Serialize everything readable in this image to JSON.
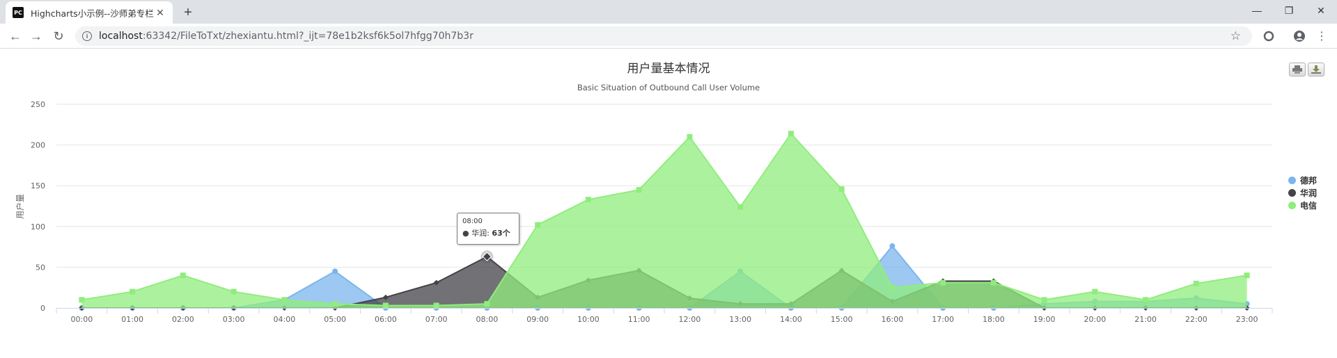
{
  "browser": {
    "tab_title": "Highcharts小示例--沙师弟专栏",
    "favicon_text": "PC",
    "url_host": "localhost",
    "url_rest": ":63342/FileToTxt/zhexiantu.html?_ijt=78e1b2ksf6k5ol7hfgg70h7b3r"
  },
  "colors": {
    "debang": "#7cb5ec",
    "huarun": "#434348",
    "dianxin": "#90ed7d"
  },
  "icons": [
    "back-icon",
    "forward-icon",
    "reload-icon",
    "info-icon",
    "star-icon",
    "extension-icon",
    "profile-icon",
    "menu-icon",
    "print-icon",
    "download-icon"
  ],
  "chart_data": {
    "type": "area",
    "title": "用户量基本情况",
    "subtitle": "Basic Situation of Outbound Call User Volume",
    "ylabel": "用户量",
    "xlabel": "",
    "ylim": [
      0,
      250
    ],
    "yticks": [
      0,
      50,
      100,
      150,
      200,
      250
    ],
    "grid": true,
    "legend_position": "right",
    "categories": [
      "00:00",
      "01:00",
      "02:00",
      "03:00",
      "04:00",
      "05:00",
      "06:00",
      "07:00",
      "08:00",
      "09:00",
      "10:00",
      "11:00",
      "12:00",
      "13:00",
      "14:00",
      "15:00",
      "16:00",
      "17:00",
      "18:00",
      "19:00",
      "20:00",
      "21:00",
      "22:00",
      "23:00"
    ],
    "series": [
      {
        "name": "德邦",
        "color": "#7cb5ec",
        "marker": "circle",
        "values": [
          0,
          0,
          0,
          0,
          10,
          45,
          0,
          0,
          0,
          0,
          0,
          0,
          0,
          45,
          0,
          0,
          76,
          0,
          0,
          5,
          8,
          8,
          12,
          5
        ]
      },
      {
        "name": "华润",
        "color": "#434348",
        "marker": "diamond",
        "values": [
          0,
          0,
          0,
          0,
          0,
          0,
          13,
          31,
          63,
          13,
          34,
          46,
          12,
          5,
          5,
          46,
          8,
          33,
          33,
          0,
          0,
          0,
          0,
          0
        ]
      },
      {
        "name": "电信",
        "color": "#90ed7d",
        "marker": "square",
        "values": [
          10,
          20,
          40,
          20,
          10,
          5,
          3,
          3,
          5,
          102,
          133,
          145,
          210,
          124,
          214,
          146,
          25,
          31,
          31,
          10,
          20,
          10,
          30,
          40
        ]
      }
    ],
    "tooltip": {
      "x": "08:00",
      "series": "华润",
      "value": "63个"
    }
  }
}
